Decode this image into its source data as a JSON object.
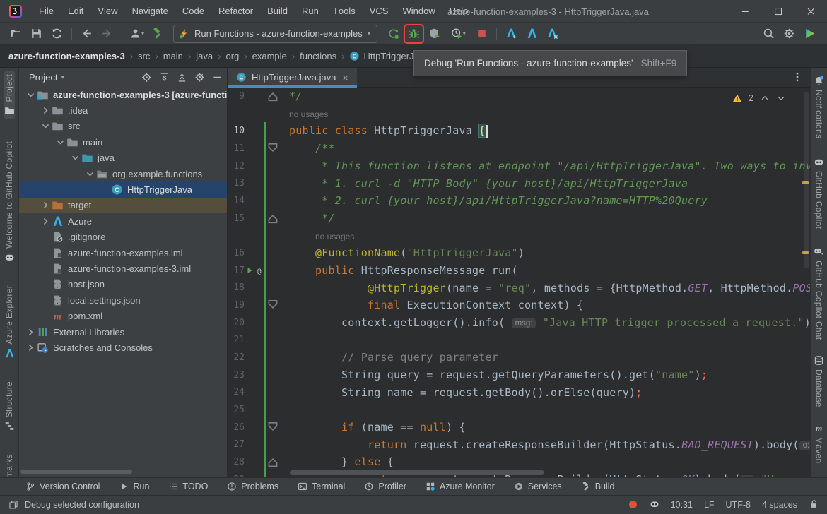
{
  "window": {
    "title": "azure-function-examples-3 - HttpTriggerJava.java"
  },
  "menubar": {
    "items": [
      {
        "label": "File",
        "m": 0
      },
      {
        "label": "Edit",
        "m": 0
      },
      {
        "label": "View",
        "m": 0
      },
      {
        "label": "Navigate",
        "m": 0
      },
      {
        "label": "Code",
        "m": 0
      },
      {
        "label": "Refactor",
        "m": 0
      },
      {
        "label": "Build",
        "m": 0
      },
      {
        "label": "Run",
        "m": 1
      },
      {
        "label": "Tools",
        "m": 0
      },
      {
        "label": "VCS",
        "m": 2
      },
      {
        "label": "Window",
        "m": 0
      },
      {
        "label": "Help",
        "m": 0
      }
    ]
  },
  "toolbar": {
    "file_icons": [
      {
        "icon": "open-folder"
      },
      {
        "icon": "save"
      },
      {
        "icon": "sync"
      }
    ],
    "nav_icons": [
      {
        "icon": "arrow-back"
      },
      {
        "icon": "arrow-forward",
        "disabled": true
      }
    ],
    "user_icon": "user",
    "build_icon": "hammer-green",
    "run_config": {
      "icon": "azure-functions-lightning",
      "label": "Run Functions - azure-function-examples"
    },
    "run_actions": [
      {
        "icon": "rerun"
      },
      {
        "icon": "debug-bug",
        "highlighted": true
      },
      {
        "icon": "coverage-shield"
      },
      {
        "icon": "profiler-clock",
        "dropdown": true
      },
      {
        "icon": "stop"
      }
    ],
    "azure_actions": [
      {
        "icon": "azure-deploy"
      },
      {
        "icon": "azure-a"
      },
      {
        "icon": "azure-config"
      }
    ],
    "right_icons": [
      {
        "icon": "search"
      },
      {
        "icon": "settings-gear"
      },
      {
        "icon": "colorful-play"
      }
    ]
  },
  "tooltip": {
    "text": "Debug 'Run Functions - azure-function-examples'",
    "shortcut": "Shift+F9"
  },
  "breadcrumbs": {
    "items": [
      {
        "label": "azure-function-examples-3",
        "bold": true
      },
      {
        "label": "src"
      },
      {
        "label": "main"
      },
      {
        "label": "java"
      },
      {
        "label": "org"
      },
      {
        "label": "example"
      },
      {
        "label": "functions"
      },
      {
        "label": "HttpTriggerJava",
        "icon": "class"
      }
    ]
  },
  "left_stripe": {
    "items": [
      {
        "label": "Project",
        "icon": "folder-tool",
        "active": true
      },
      {
        "label": "Welcome to GitHub Copilot",
        "icon": "copilot"
      },
      {
        "label": "Azure Explorer",
        "icon": "azure-a"
      },
      {
        "label": "Structure",
        "icon": "structure"
      },
      {
        "label": "Bookmarks",
        "icon": "bookmark"
      }
    ]
  },
  "right_stripe": {
    "items": [
      {
        "label": "Notifications",
        "icon": "bell-badge"
      },
      {
        "label": "GitHub Copilot",
        "icon": "copilot"
      },
      {
        "label": "GitHub Copilot Chat",
        "icon": "copilot-chat"
      },
      {
        "label": "Database",
        "icon": "database"
      },
      {
        "label": "Maven",
        "icon": "maven-gray"
      }
    ]
  },
  "project_panel": {
    "title": "Project",
    "header_icons": [
      {
        "icon": "locate"
      },
      {
        "icon": "expand-all"
      },
      {
        "icon": "collapse-all"
      },
      {
        "icon": "settings-gear"
      },
      {
        "icon": "minimize"
      }
    ],
    "tree": [
      {
        "i": 0,
        "ch": "open",
        "icon": "folder-project",
        "label": "azure-function-examples-3 [azure-functi",
        "bold": true
      },
      {
        "i": 1,
        "ch": "closed",
        "icon": "folder",
        "label": ".idea"
      },
      {
        "i": 1,
        "ch": "open",
        "icon": "folder",
        "label": "src"
      },
      {
        "i": 2,
        "ch": "open",
        "icon": "folder",
        "label": "main"
      },
      {
        "i": 3,
        "ch": "open",
        "icon": "folder-source",
        "label": "java"
      },
      {
        "i": 4,
        "ch": "open",
        "icon": "package",
        "label": "org.example.functions"
      },
      {
        "i": 5,
        "ch": null,
        "icon": "class",
        "label": "HttpTriggerJava",
        "selected": true
      },
      {
        "i": 1,
        "ch": "closed",
        "icon": "folder-excluded",
        "label": "target",
        "hovered": true
      },
      {
        "i": 1,
        "ch": "closed",
        "icon": "azure-a",
        "label": "Azure"
      },
      {
        "i": 1,
        "ch": null,
        "icon": "file-ignored",
        "label": ".gitignore"
      },
      {
        "i": 1,
        "ch": null,
        "icon": "file-iml",
        "label": "azure-function-examples.iml"
      },
      {
        "i": 1,
        "ch": null,
        "icon": "file-iml",
        "label": "azure-function-examples-3.iml"
      },
      {
        "i": 1,
        "ch": null,
        "icon": "file-json",
        "label": "host.json"
      },
      {
        "i": 1,
        "ch": null,
        "icon": "file-json",
        "label": "local.settings.json"
      },
      {
        "i": 1,
        "ch": null,
        "icon": "maven",
        "label": "pom.xml"
      },
      {
        "i": 0,
        "ch": "closed",
        "icon": "library",
        "label": "External Libraries"
      },
      {
        "i": 0,
        "ch": "closed",
        "icon": "scratches",
        "label": "Scratches and Consoles"
      }
    ]
  },
  "editor": {
    "tab_label": "HttpTriggerJava.java",
    "warning_count": "2",
    "rows": [
      {
        "n": "9",
        "f": "u",
        "s": [
          {
            "t": "*/",
            "c": "d"
          }
        ]
      },
      {
        "inlay": "no usages",
        "ind": 0
      },
      {
        "n": "10",
        "cur": true,
        "caret": true,
        "s": [
          {
            "t": "public class ",
            "c": "k"
          },
          {
            "t": "HttpTriggerJava ",
            "c": "t"
          },
          {
            "t": "{",
            "c": "b"
          }
        ]
      },
      {
        "n": "11",
        "f": "d",
        "s": [
          {
            "t": "    /**",
            "c": "d"
          }
        ]
      },
      {
        "n": "12",
        "s": [
          {
            "t": "     * This function listens at endpoint \"/api/HttpTriggerJava\". Two ways to invo",
            "c": "d"
          }
        ]
      },
      {
        "n": "13",
        "s": [
          {
            "t": "     * 1. curl -d \"HTTP Body\" {your host}/api/HttpTriggerJava",
            "c": "d"
          }
        ]
      },
      {
        "n": "14",
        "s": [
          {
            "t": "     * 2. curl {your host}/api/HttpTriggerJava?name=HTTP%20Query",
            "c": "d"
          }
        ]
      },
      {
        "n": "15",
        "f": "u",
        "s": [
          {
            "t": "     */",
            "c": "d"
          }
        ]
      },
      {
        "inlay": "no usages",
        "ind": 4
      },
      {
        "n": "16",
        "s": [
          {
            "t": "    ",
            "c": "t"
          },
          {
            "t": "@FunctionName",
            "c": "a"
          },
          {
            "t": "(",
            "c": "t"
          },
          {
            "t": "\"HttpTriggerJava\"",
            "c": "s"
          },
          {
            "t": ")",
            "c": "t"
          }
        ]
      },
      {
        "n": "17",
        "g": true,
        "s": [
          {
            "t": "    ",
            "c": "t"
          },
          {
            "t": "public ",
            "c": "k"
          },
          {
            "t": "HttpResponseMessage run(",
            "c": "t"
          }
        ]
      },
      {
        "n": "18",
        "s": [
          {
            "t": "            ",
            "c": "t"
          },
          {
            "t": "@HttpTrigger",
            "c": "a"
          },
          {
            "t": "(name = ",
            "c": "t"
          },
          {
            "t": "\"req\"",
            "c": "s"
          },
          {
            "t": ", methods = {HttpMethod.",
            "c": "t"
          },
          {
            "t": "GET",
            "c": "p"
          },
          {
            "t": ", HttpMethod.",
            "c": "t"
          },
          {
            "t": "POST",
            "c": "p"
          }
        ]
      },
      {
        "n": "19",
        "f": "d",
        "s": [
          {
            "t": "            ",
            "c": "t"
          },
          {
            "t": "final ",
            "c": "k"
          },
          {
            "t": "ExecutionContext context) {",
            "c": "t"
          }
        ]
      },
      {
        "n": "20",
        "s": [
          {
            "t": "        context.getLogger().info( ",
            "c": "t"
          },
          {
            "i": "msg:"
          },
          {
            "t": " ",
            "c": "t"
          },
          {
            "t": "\"Java HTTP trigger processed a request.\"",
            "c": "s"
          },
          {
            "t": ");",
            "c": "t"
          }
        ]
      },
      {
        "n": "21",
        "s": []
      },
      {
        "n": "22",
        "s": [
          {
            "t": "        ",
            "c": "t"
          },
          {
            "t": "// Parse query parameter",
            "c": "c"
          }
        ]
      },
      {
        "n": "23",
        "s": [
          {
            "t": "        String query = request.getQueryParameters().get(",
            "c": "t"
          },
          {
            "t": "\"name\"",
            "c": "s"
          },
          {
            "t": ")",
            "c": "t"
          },
          {
            "t": ";",
            "c": "e"
          }
        ]
      },
      {
        "n": "24",
        "s": [
          {
            "t": "        String name = request.getBody().orElse(query)",
            "c": "t"
          },
          {
            "t": ";",
            "c": "e"
          }
        ]
      },
      {
        "n": "25",
        "s": []
      },
      {
        "n": "26",
        "f": "d",
        "s": [
          {
            "t": "        ",
            "c": "t"
          },
          {
            "t": "if ",
            "c": "k"
          },
          {
            "t": "(name == ",
            "c": "t"
          },
          {
            "t": "null",
            "c": "k"
          },
          {
            "t": ") {",
            "c": "t"
          }
        ]
      },
      {
        "n": "27",
        "s": [
          {
            "t": "            ",
            "c": "t"
          },
          {
            "t": "return ",
            "c": "k"
          },
          {
            "t": "request.createResponseBuilder(HttpStatus.",
            "c": "t"
          },
          {
            "t": "BAD_REQUEST",
            "c": "p"
          },
          {
            "t": ").body(",
            "c": "t"
          },
          {
            "i": "o:"
          }
        ]
      },
      {
        "n": "28",
        "f": "u",
        "s": [
          {
            "t": "        } ",
            "c": "t"
          },
          {
            "t": "else ",
            "c": "k"
          },
          {
            "t": "{",
            "c": "t"
          }
        ]
      },
      {
        "n": "29",
        "s": [
          {
            "t": "            ",
            "c": "t"
          },
          {
            "t": "return ",
            "c": "k"
          },
          {
            "t": "request.createResponseBuilder(HttpStatus.",
            "c": "t"
          },
          {
            "t": "OK",
            "c": "p"
          },
          {
            "t": ").body(",
            "c": "t"
          },
          {
            "i": "o:"
          },
          {
            "t": " \"H",
            "c": "s"
          }
        ]
      }
    ]
  },
  "bottom_bar": {
    "items": [
      {
        "label": "Version Control",
        "icon": "branch"
      },
      {
        "label": "Run",
        "icon": "play"
      },
      {
        "label": "TODO",
        "icon": "todo-list"
      },
      {
        "label": "Problems",
        "icon": "problems"
      },
      {
        "label": "Terminal",
        "icon": "terminal"
      },
      {
        "label": "Profiler",
        "icon": "profiler-clock-gray"
      },
      {
        "label": "Azure Monitor",
        "icon": "azure-monitor"
      },
      {
        "label": "Services",
        "icon": "services"
      },
      {
        "label": "Build",
        "icon": "hammer-gray"
      }
    ]
  },
  "status_bar": {
    "left_icon": "stack",
    "left_text": "Debug selected configuration",
    "right": [
      {
        "icon": "record-dot",
        "name": "recording-indicator"
      },
      {
        "icon": "copilot",
        "name": "copilot-status"
      },
      {
        "label": "10:31",
        "name": "caret-position"
      },
      {
        "label": "LF",
        "name": "line-separator"
      },
      {
        "label": "UTF-8",
        "name": "file-encoding"
      },
      {
        "label": "4 spaces",
        "name": "indent-size"
      },
      {
        "icon": "unlock",
        "name": "readonly-toggle"
      }
    ]
  },
  "colors": {
    "accent_blue": "#4a88c7",
    "selection_blue": "#26436a",
    "vcs_green": "#499c54",
    "warning_yellow": "#efbb4b",
    "error_red": "#ff6b68",
    "debug_highlight_red": "#e8443a",
    "azure_blue": "#35b1e4",
    "run_green": "#57a64a"
  }
}
